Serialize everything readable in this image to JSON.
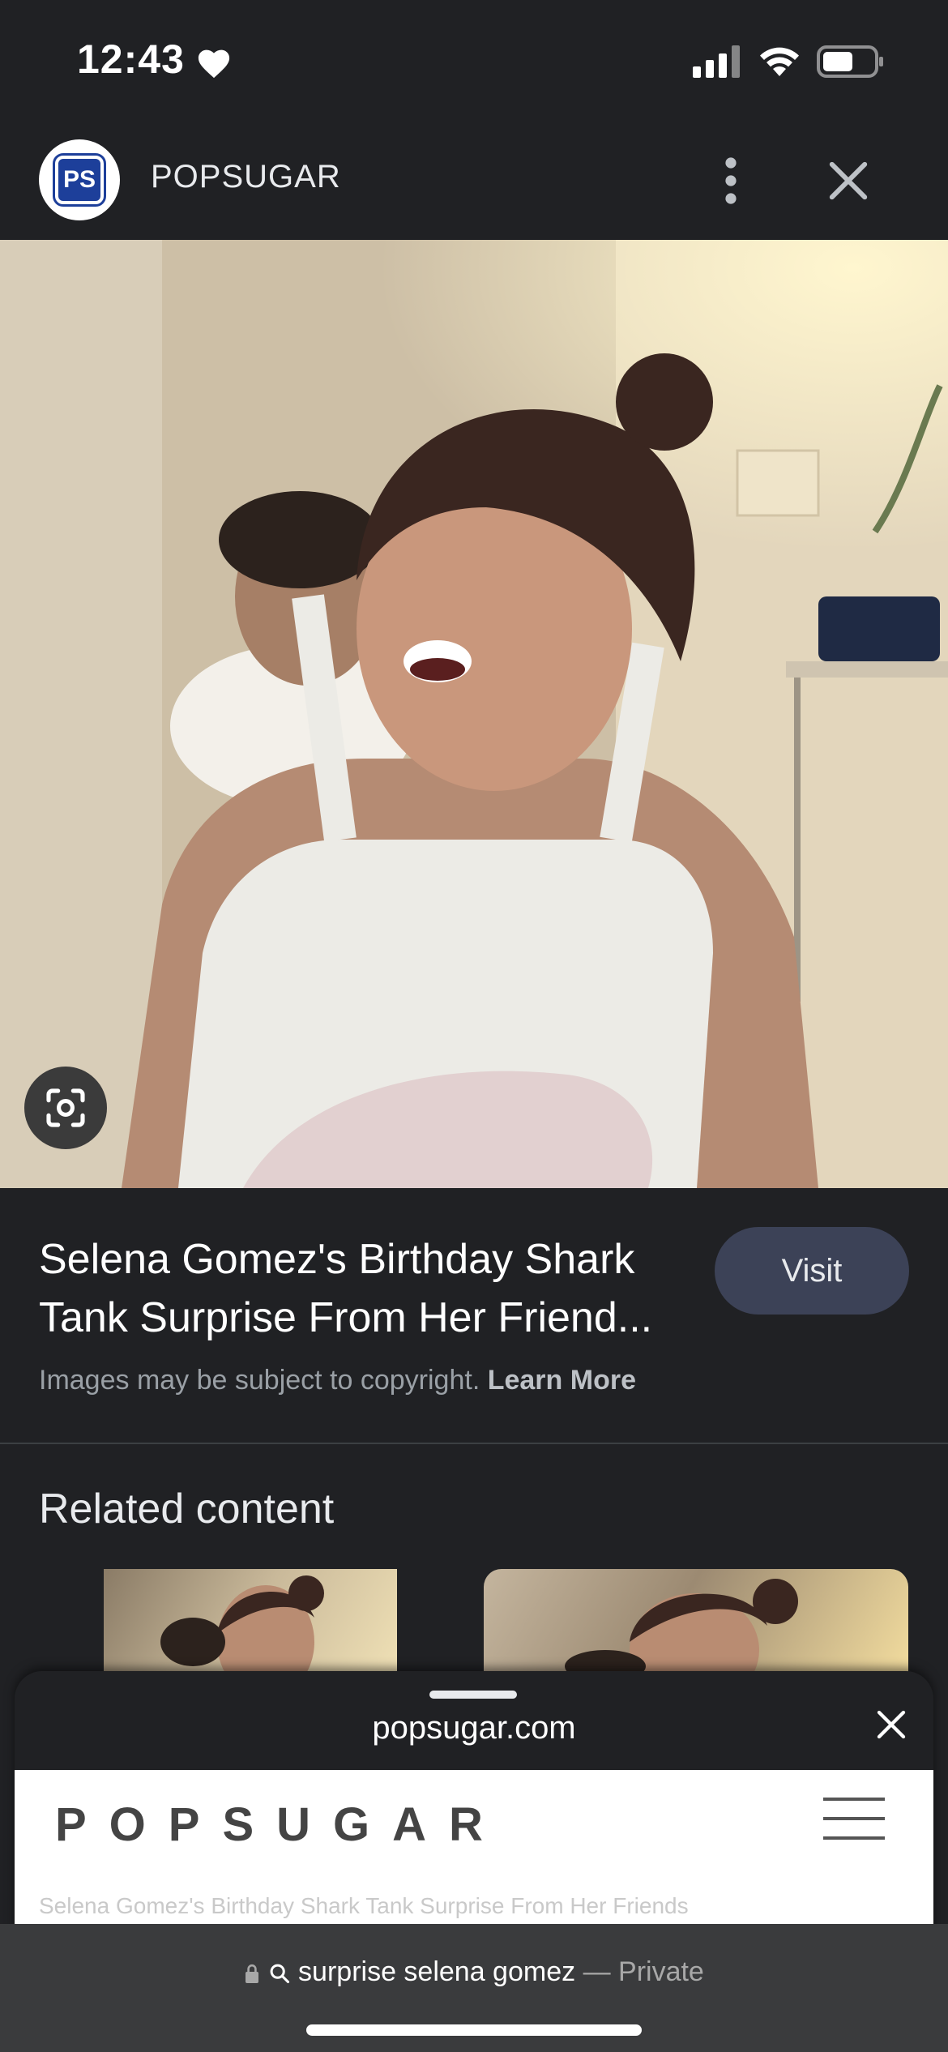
{
  "status_bar": {
    "time": "12:43"
  },
  "header": {
    "site_name": "POPSUGAR",
    "logo_text": "PS"
  },
  "result": {
    "title": "Selena Gomez's Birthday Shark Tank Surprise From Her Friend...",
    "visit_label": "Visit",
    "copyright_text": "Images may be subject to copyright.",
    "learn_more_label": "Learn More"
  },
  "related": {
    "title": "Related content"
  },
  "sheet": {
    "url": "popsugar.com",
    "web_logo": "POPSUGAR",
    "web_subtitle": "Selena Gomez's Birthday Shark Tank Surprise From Her Friends"
  },
  "browser_bar": {
    "query": "surprise selena gomez",
    "separator": "—",
    "mode": "Private"
  }
}
